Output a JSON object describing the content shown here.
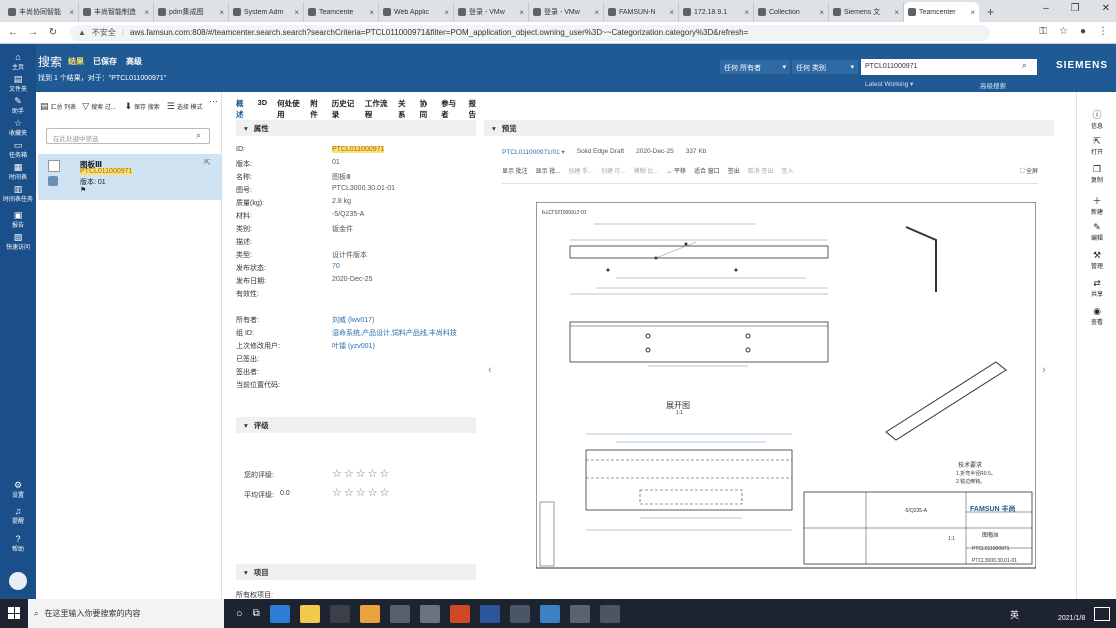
{
  "browser": {
    "tabs": [
      "丰尚协同智能",
      "丰尚智能制造",
      "pdm集成图",
      "System Adm",
      "Teamcente",
      "Web Applic",
      "登录 - VMw",
      "登录 - VMw",
      "FAMSUN-N",
      "172.18.9.1",
      "Collection",
      "Siemens 文",
      "Teamcenter"
    ],
    "insecure_label": "不安全",
    "url": "aws.famsun.com:808/#/teamcenter.search.search?searchCriteria=PTCL011000971&filter=POM_application_object.owning_user%3D~~Categorization.category%3D&refresh="
  },
  "rail": [
    {
      "icon": "home-icon",
      "label": "主页"
    },
    {
      "icon": "folder-icon",
      "label": "文件夹"
    },
    {
      "icon": "helper-icon",
      "label": "助手"
    },
    {
      "icon": "star-icon",
      "label": "收藏夹"
    },
    {
      "icon": "inbox-icon",
      "label": "任务箱"
    },
    {
      "icon": "calendar-icon",
      "label": "时间表"
    },
    {
      "icon": "schedule-task-icon",
      "label": "时间表任务"
    },
    {
      "icon": "report-icon",
      "label": "报告"
    },
    {
      "icon": "quick-access-icon",
      "label": "快速访问"
    },
    {
      "icon": "gear-icon",
      "label": "设置"
    },
    {
      "icon": "bell-icon",
      "label": "提醒"
    },
    {
      "icon": "help-icon",
      "label": "帮助"
    }
  ],
  "header": {
    "title": "搜索",
    "tabs": [
      "结果",
      "已保存",
      "高级"
    ],
    "summary": "找到 1 个结果，对于：\"PTCL011000971\"",
    "owner_filter": "任何 所有者",
    "category_filter": "任何 类别",
    "search_value": "PTCL011000971",
    "working_label": "Latest Working ▾",
    "advanced_search": "高级搜索",
    "brand": "SIEMENS"
  },
  "left": {
    "toolbar": [
      "汇总 列表",
      "搜索 过...",
      "保存 搜索",
      "选择 模式"
    ],
    "filter_placeholder": "在此处键中筛选",
    "result": {
      "name": "图板Ⅲ",
      "id": "PTCL011000971",
      "revision": "版本: 01"
    }
  },
  "mid": {
    "tabs": [
      "概述",
      "3D",
      "何处使用",
      "附件",
      "历史记录",
      "工作流程",
      "关系",
      "协同",
      "参与者",
      "报告"
    ],
    "props_title": "属性",
    "props": [
      {
        "label": "ID:",
        "value": "PTCL011000971",
        "hl": true
      },
      {
        "label": "版本:",
        "value": "01"
      },
      {
        "label": "名称:",
        "value": "图板Ⅲ"
      },
      {
        "label": "图号:",
        "value": "PTCL3000.30.01-01"
      },
      {
        "label": "质量(kg):",
        "value": "2.8 kg"
      },
      {
        "label": "材料:",
        "value": "-5/Q235-A"
      },
      {
        "label": "类别:",
        "value": "钣金件"
      },
      {
        "label": "描述:",
        "value": ""
      },
      {
        "label": "类型:",
        "value": "设计件版本"
      },
      {
        "label": "发布状态:",
        "value": "70",
        "link": true
      },
      {
        "label": "发布日期:",
        "value": "2020-Dec-25"
      },
      {
        "label": "有效性:",
        "value": ""
      }
    ],
    "props2": [
      {
        "label": "所有者:",
        "value": "刘威 (lwv017)",
        "link": true
      },
      {
        "label": "组 ID:",
        "value": "湿命系统,产品设计,饲料产品线,丰尚科技",
        "link": true
      },
      {
        "label": "上次修改用户:",
        "value": "叶镭 (yzv001)",
        "link": true
      },
      {
        "label": "已签出:",
        "value": ""
      },
      {
        "label": "签出者:",
        "value": ""
      },
      {
        "label": "当前位置代码:",
        "value": ""
      }
    ],
    "rating_title": "评级",
    "my_rating": "您的评级:",
    "avg_rating": "平均评级:",
    "avg_value": "0.0",
    "project_title": "项目",
    "project_row": "所有权项目:"
  },
  "preview": {
    "title": "预览",
    "file": "PTCL011000971/01 ▾",
    "app": "Solid Edge Draft",
    "date": "2020-Dec-25",
    "size": "337 Kb",
    "tools": [
      "显示 批注",
      "显示 批...",
      "创建 手...",
      "创建 形...",
      "模糊 比...",
      "平移",
      "适合 窗口",
      "签出",
      "取消 签出",
      "签入"
    ],
    "fullscreen": "全屏",
    "drawing_id": "PTCL011000971-01",
    "unfold_label": "展开图",
    "unfold_ratio": "1:1",
    "tech_title": "技术要求",
    "tech_lines": [
      "1.折弯半径R0.5。",
      "2.锐边倒钝。"
    ],
    "company": "FAMSUN 丰尚",
    "part_name": "图板Ⅲ",
    "material": "-5/Q235-A",
    "drawing_no": "PTCL3000.30.01-01",
    "doc_no": "PTCL011000971",
    "scale": "1:1"
  },
  "rrail": [
    "信息",
    "打开",
    "复制",
    "新建",
    "编辑",
    "管理",
    "共享",
    "查看"
  ],
  "taskbar": {
    "search_text": "在这里输入你要搜索的内容",
    "ime": "英",
    "date": "2021/1/8"
  },
  "colors": {
    "header": "#1f5a94",
    "rail": "#1b4f8a",
    "highlight": "#f4e27a",
    "selected": "#cfe3f3"
  }
}
